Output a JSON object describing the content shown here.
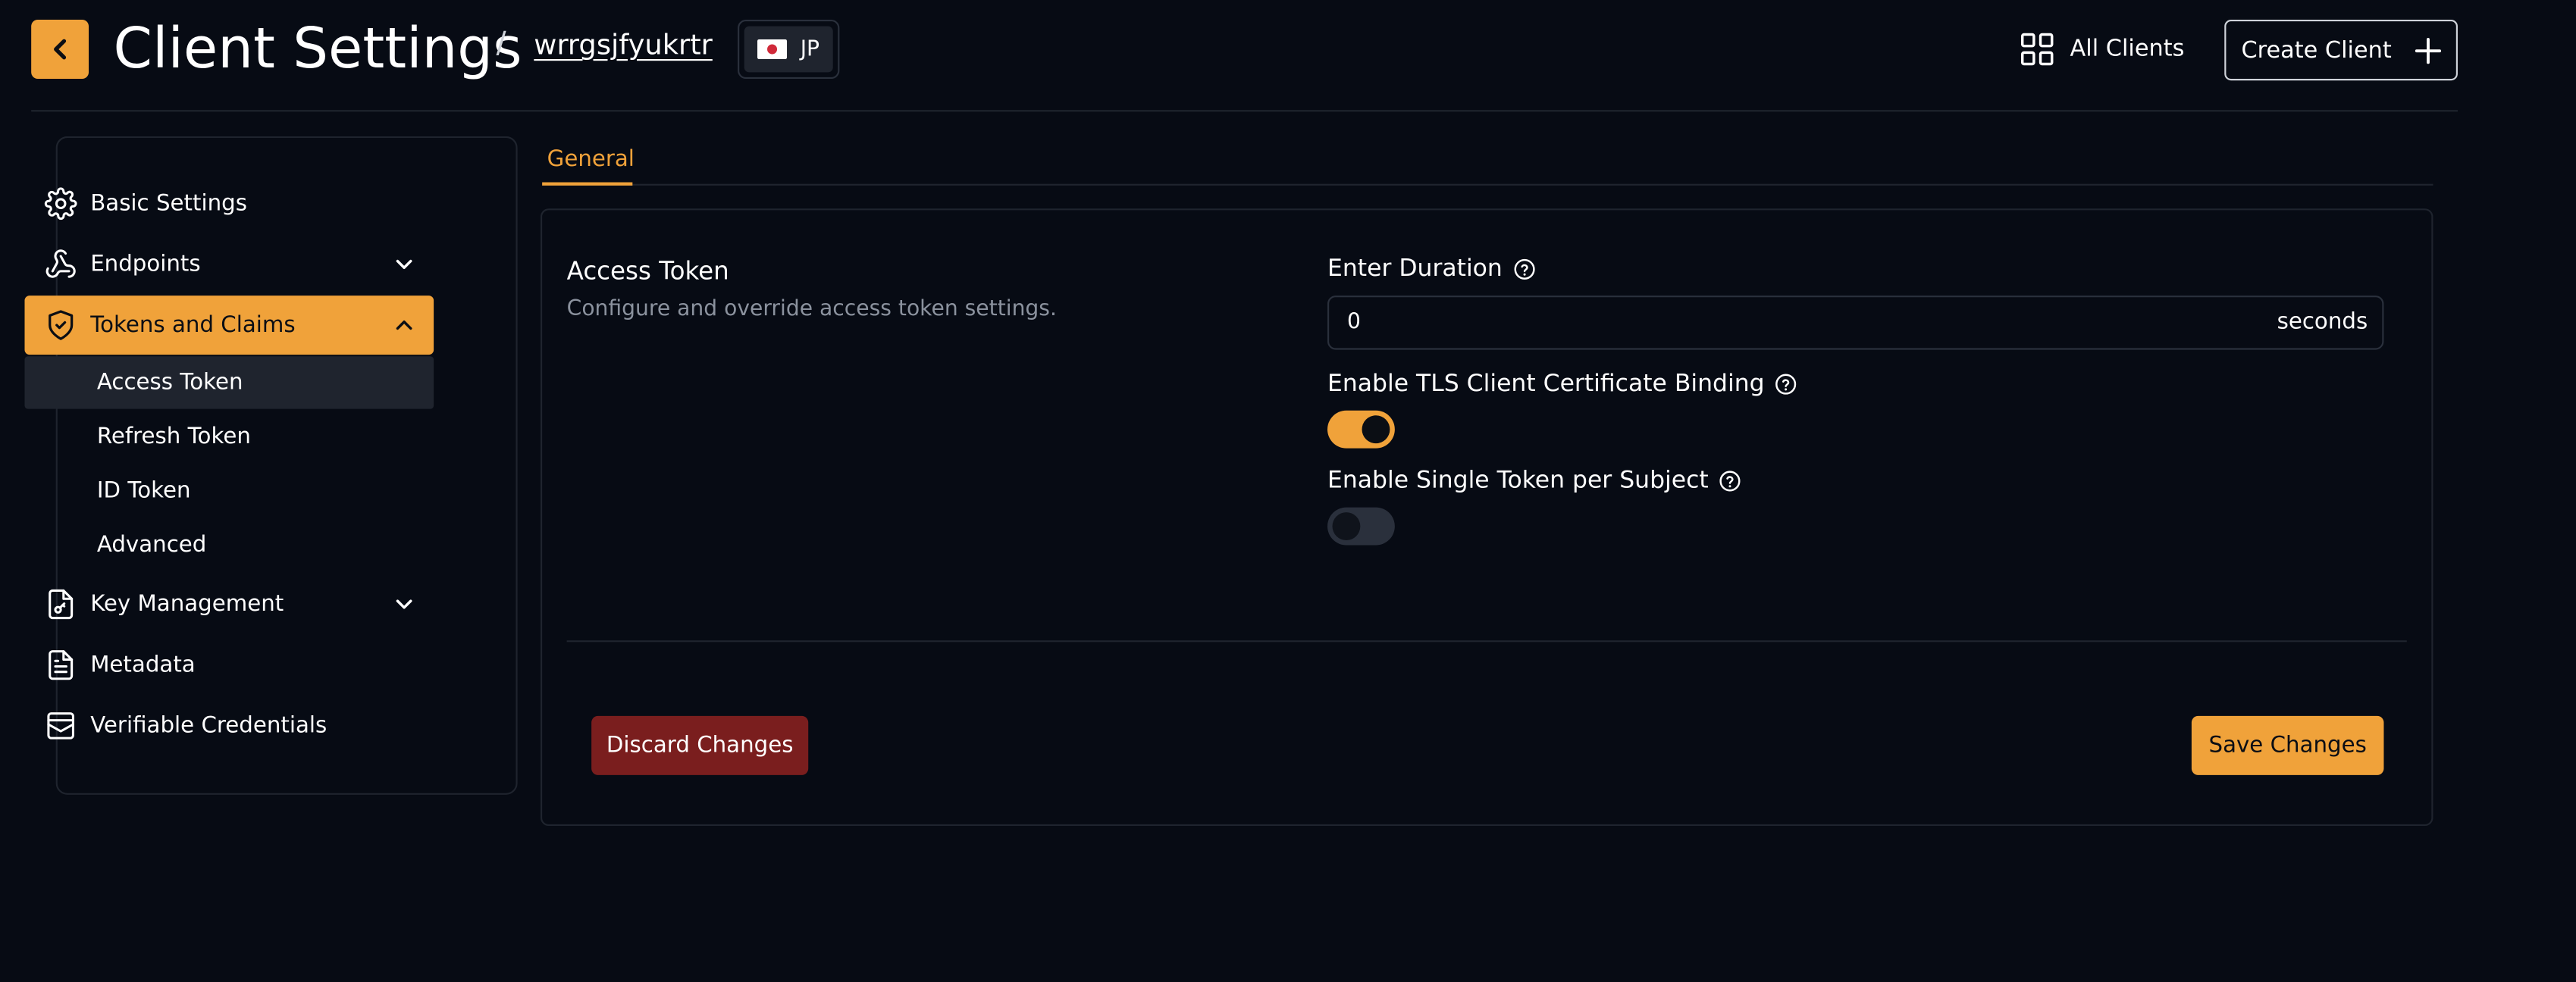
{
  "header": {
    "title": "Client Settings",
    "separator": "/",
    "client_id": "wrrgsjfyukrtr",
    "region_code": "JP",
    "all_clients_label": "All Clients",
    "create_client_label": "Create Client",
    "icons": {
      "back": "chevron-left-icon",
      "flag": "japan-flag-icon",
      "grid": "grid-icon",
      "plus": "plus-icon"
    }
  },
  "sidebar": {
    "items": [
      {
        "label": "Basic Settings",
        "icon": "gear-icon"
      },
      {
        "label": "Endpoints",
        "icon": "webhook-icon",
        "expandable": true
      },
      {
        "label": "Tokens and Claims",
        "icon": "shield-check-icon",
        "expandable": true,
        "expanded": true,
        "active": true,
        "children": [
          {
            "label": "Access Token",
            "active": true
          },
          {
            "label": "Refresh Token"
          },
          {
            "label": "ID Token"
          },
          {
            "label": "Advanced"
          }
        ]
      },
      {
        "label": "Key Management",
        "icon": "file-key-icon",
        "expandable": true
      },
      {
        "label": "Metadata",
        "icon": "file-text-icon"
      },
      {
        "label": "Verifiable Credentials",
        "icon": "credential-icon"
      }
    ]
  },
  "tabs": [
    {
      "label": "General",
      "active": true
    }
  ],
  "section": {
    "title": "Access Token",
    "description": "Configure and override access token settings."
  },
  "fields": {
    "duration": {
      "label": "Enter Duration",
      "value": "0",
      "unit": "seconds"
    },
    "tls_binding": {
      "label": "Enable TLS Client Certificate Binding",
      "enabled": true
    },
    "single_token": {
      "label": "Enable Single Token per Subject",
      "enabled": false
    }
  },
  "actions": {
    "discard_label": "Discard Changes",
    "save_label": "Save Changes"
  },
  "colors": {
    "accent": "#f0a23a",
    "background": "#070b14",
    "danger": "#7a1e1e",
    "border": "#1f242e"
  }
}
